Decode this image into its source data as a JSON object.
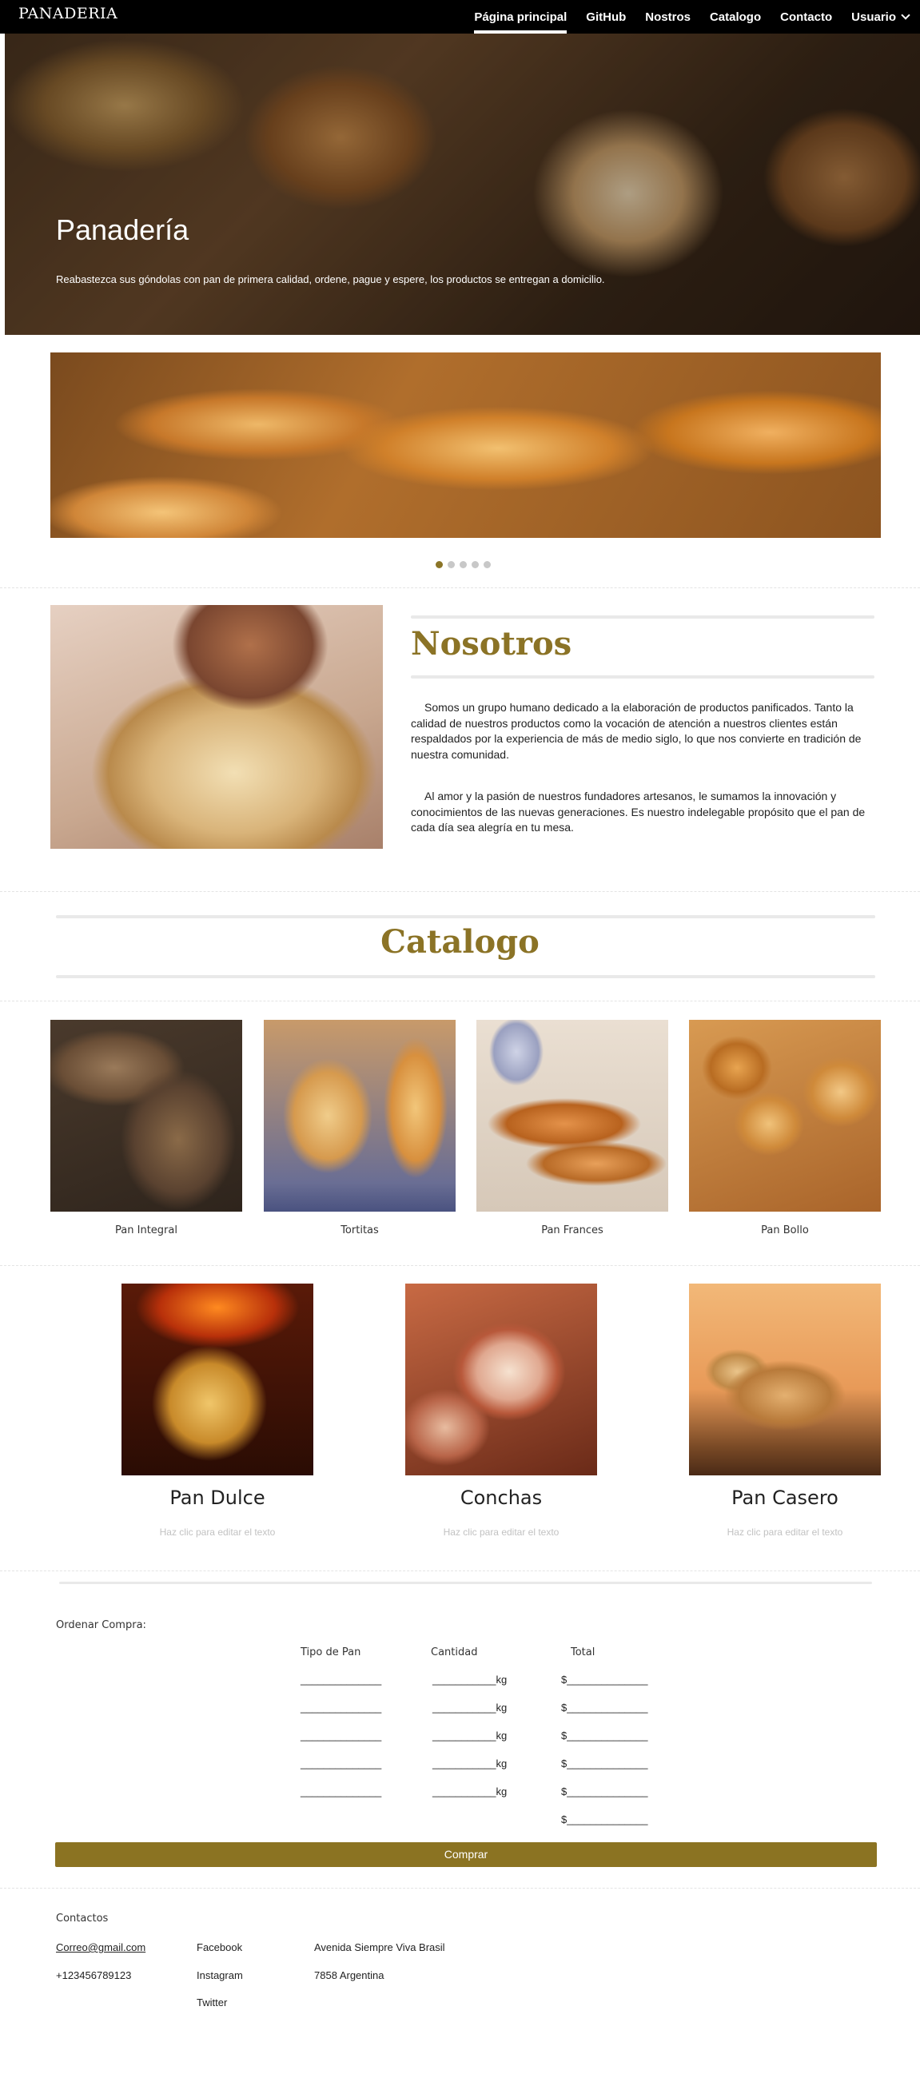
{
  "navbar": {
    "brand": "PANADERIA",
    "links": [
      {
        "label": "Página principal",
        "active": true
      },
      {
        "label": "GitHub",
        "active": false
      },
      {
        "label": "Nostros",
        "active": false
      },
      {
        "label": "Catalogo",
        "active": false
      },
      {
        "label": "Contacto",
        "active": false
      },
      {
        "label": "Usuario",
        "active": false,
        "dropdown": true
      }
    ]
  },
  "hero": {
    "title": "Panadería",
    "subtitle": "Reabastezca sus góndolas con pan de primera calidad, ordene, pague y espere, los productos se entregan a domicilio."
  },
  "carousel": {
    "slide_count": 5,
    "active_slide": 1
  },
  "nosotros": {
    "title": "Nosotros",
    "paragraphs": [
      "Somos un grupo humano dedicado a la elaboración de productos panificados. Tanto la calidad de nuestros productos como la vocación de atención a nuestros clientes están respaldados por la experiencia de más de medio siglo, lo que nos convierte en tradición de nuestra comunidad.",
      "Al amor y la pasión de nuestros fundadores artesanos, le sumamos la innovación y conocimientos de las nuevas generaciones. Es nuestro indelegable propósito que el pan de cada día sea alegría en tu mesa."
    ]
  },
  "catalogo": {
    "title": "Catalogo",
    "items": [
      "Pan Integral",
      "Tortitas",
      "Pan Frances",
      "Pan Bollo"
    ],
    "products": [
      {
        "title": "Pan Dulce",
        "subtitle": "Haz clic para editar el texto"
      },
      {
        "title": "Conchas",
        "subtitle": "Haz clic para editar el texto"
      },
      {
        "title": "Pan Casero",
        "subtitle": "Haz clic para editar el texto"
      }
    ]
  },
  "order": {
    "label": "Ordenar Compra:",
    "headers": {
      "type": "Tipo de Pan",
      "qty": "Cantidad",
      "total": "Total"
    },
    "type_blank": "______________",
    "qty_blank": "___________kg",
    "total_blank": "$______________",
    "button": "Comprar"
  },
  "footer": {
    "heading": "Contactos",
    "email": "Correo@gmail.com",
    "phone": "+123456789123",
    "social": [
      "Facebook",
      "Instagram",
      "Twitter"
    ],
    "address1": "Avenida Siempre Viva Brasil",
    "address2": "7858 Argentina"
  }
}
